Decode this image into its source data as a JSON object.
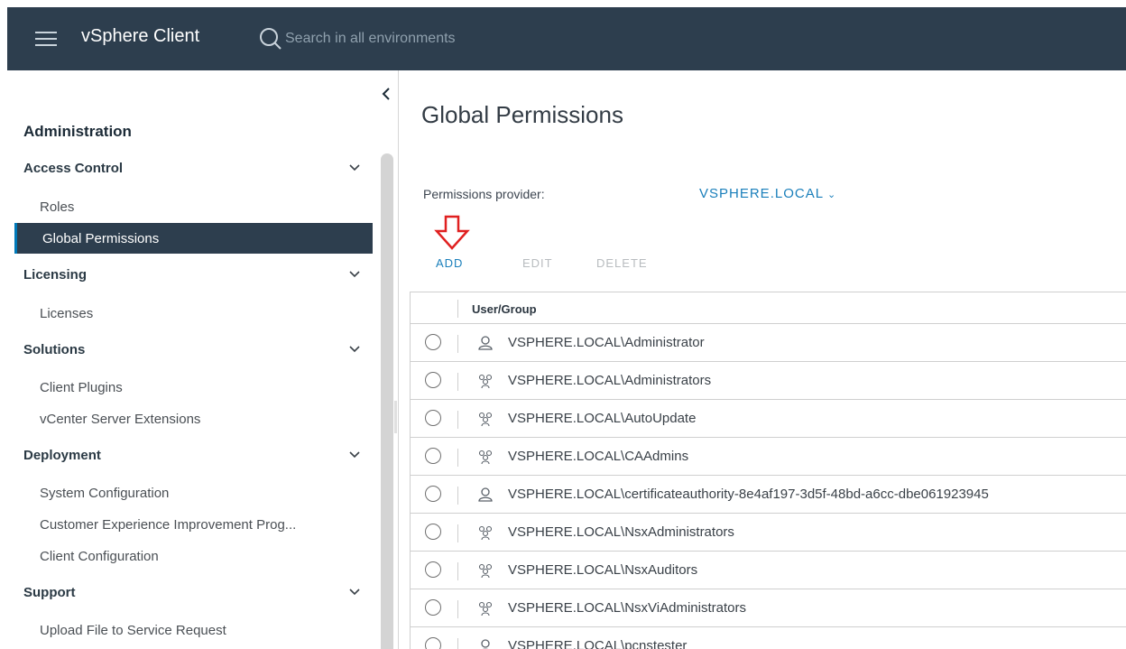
{
  "header": {
    "title": "vSphere Client",
    "search_placeholder": "Search in all environments",
    "bg_color": "#2d3e4e"
  },
  "sidebar": {
    "heading": "Administration",
    "groups": [
      {
        "label": "Access Control",
        "items": [
          "Roles",
          "Global Permissions"
        ]
      },
      {
        "label": "Licensing",
        "items": [
          "Licenses"
        ]
      },
      {
        "label": "Solutions",
        "items": [
          "Client Plugins",
          "vCenter Server Extensions"
        ]
      },
      {
        "label": "Deployment",
        "items": [
          "System Configuration",
          "Customer Experience Improvement Prog...",
          "Client Configuration"
        ]
      },
      {
        "label": "Support",
        "items": [
          "Upload File to Service Request"
        ]
      }
    ],
    "active_item": "Global Permissions"
  },
  "main": {
    "title": "Global Permissions",
    "provider_label": "Permissions provider:",
    "provider_value": "VSPHERE.LOCAL",
    "toolbar": {
      "add": "ADD",
      "edit": "EDIT",
      "delete": "DELETE"
    },
    "table": {
      "column_header": "User/Group",
      "rows": [
        {
          "type": "user",
          "name": "VSPHERE.LOCAL\\Administrator"
        },
        {
          "type": "group",
          "name": "VSPHERE.LOCAL\\Administrators"
        },
        {
          "type": "group",
          "name": "VSPHERE.LOCAL\\AutoUpdate"
        },
        {
          "type": "group",
          "name": "VSPHERE.LOCAL\\CAAdmins"
        },
        {
          "type": "user",
          "name": "VSPHERE.LOCAL\\certificateauthority-8e4af197-3d5f-48bd-a6cc-dbe061923945"
        },
        {
          "type": "group",
          "name": "VSPHERE.LOCAL\\NsxAdministrators"
        },
        {
          "type": "group",
          "name": "VSPHERE.LOCAL\\NsxAuditors"
        },
        {
          "type": "group",
          "name": "VSPHERE.LOCAL\\NsxViAdministrators"
        },
        {
          "type": "user",
          "name": "VSPHERE.LOCAL\\pcnstester"
        }
      ]
    }
  },
  "colors": {
    "accent": "#1a7fbb",
    "annotation_arrow": "#e02020",
    "active_nav_bg": "#2d3e4e"
  }
}
